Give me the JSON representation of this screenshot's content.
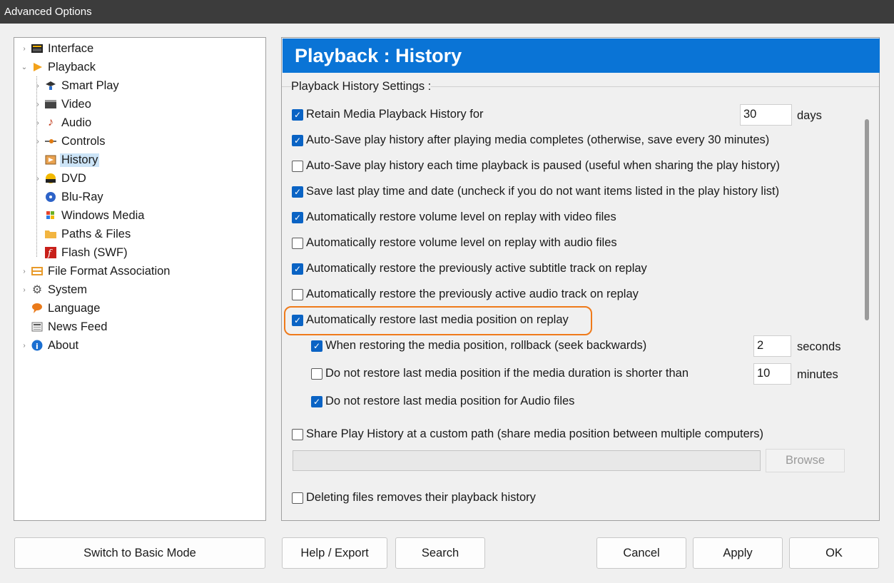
{
  "window": {
    "title": "Advanced Options"
  },
  "tree": {
    "items": [
      {
        "label": "Interface",
        "icon": "interface-icon"
      },
      {
        "label": "Playback",
        "icon": "playback-icon"
      },
      {
        "label": "Smart Play",
        "icon": "smart-play-icon"
      },
      {
        "label": "Video",
        "icon": "video-icon"
      },
      {
        "label": "Audio",
        "icon": "audio-icon"
      },
      {
        "label": "Controls",
        "icon": "controls-icon"
      },
      {
        "label": "History",
        "icon": "history-icon"
      },
      {
        "label": "DVD",
        "icon": "dvd-icon"
      },
      {
        "label": "Blu-Ray",
        "icon": "bluray-icon"
      },
      {
        "label": "Windows Media",
        "icon": "windows-media-icon"
      },
      {
        "label": "Paths & Files",
        "icon": "folder-icon"
      },
      {
        "label": "Flash (SWF)",
        "icon": "flash-icon"
      },
      {
        "label": "File Format Association",
        "icon": "file-format-icon"
      },
      {
        "label": "System",
        "icon": "gear-icon"
      },
      {
        "label": "Language",
        "icon": "language-icon"
      },
      {
        "label": "News Feed",
        "icon": "news-icon"
      },
      {
        "label": "About",
        "icon": "info-icon"
      }
    ],
    "selected": "History"
  },
  "panel": {
    "header": "Playback : History",
    "group_title": "Playback History Settings :",
    "options": [
      {
        "label": "Retain Media Playback History for",
        "checked": true
      },
      {
        "label": "Auto-Save play history after playing media completes (otherwise, save every 30 minutes)",
        "checked": true
      },
      {
        "label": "Auto-Save play history each time playback is paused (useful when sharing the play history)",
        "checked": false
      },
      {
        "label": "Save last play time and date (uncheck if you do not want items listed in the play history list)",
        "checked": true
      },
      {
        "label": "Automatically restore volume level on replay with video files",
        "checked": true
      },
      {
        "label": "Automatically restore volume level on replay with audio files",
        "checked": false
      },
      {
        "label": "Automatically restore the previously active subtitle track on replay",
        "checked": true
      },
      {
        "label": "Automatically restore the previously active audio track on replay",
        "checked": false
      },
      {
        "label": "Automatically restore last media position on replay",
        "checked": true
      },
      {
        "label": "When restoring the media position, rollback (seek backwards)",
        "checked": true
      },
      {
        "label": "Do not restore last media position if the media duration is shorter than",
        "checked": false
      },
      {
        "label": "Do not restore last media position for Audio files",
        "checked": true
      },
      {
        "label": "Share Play History at a custom path (share media position between multiple computers)",
        "checked": false
      },
      {
        "label": "Deleting files removes their playback history",
        "checked": false
      }
    ],
    "retain_days": {
      "value": "30",
      "unit": "days"
    },
    "rollback_seconds": {
      "value": "2",
      "unit": "seconds"
    },
    "min_duration": {
      "value": "10",
      "unit": "minutes"
    },
    "custom_path": {
      "value": ""
    },
    "browse_label": "Browse"
  },
  "buttons": {
    "basic_mode": "Switch to Basic Mode",
    "help_export": "Help / Export",
    "search": "Search",
    "cancel": "Cancel",
    "apply": "Apply",
    "ok": "OK"
  },
  "colors": {
    "header_blue": "#0a74d6",
    "checkbox_blue": "#0a63c4",
    "highlight_orange": "#ef7a1a"
  }
}
